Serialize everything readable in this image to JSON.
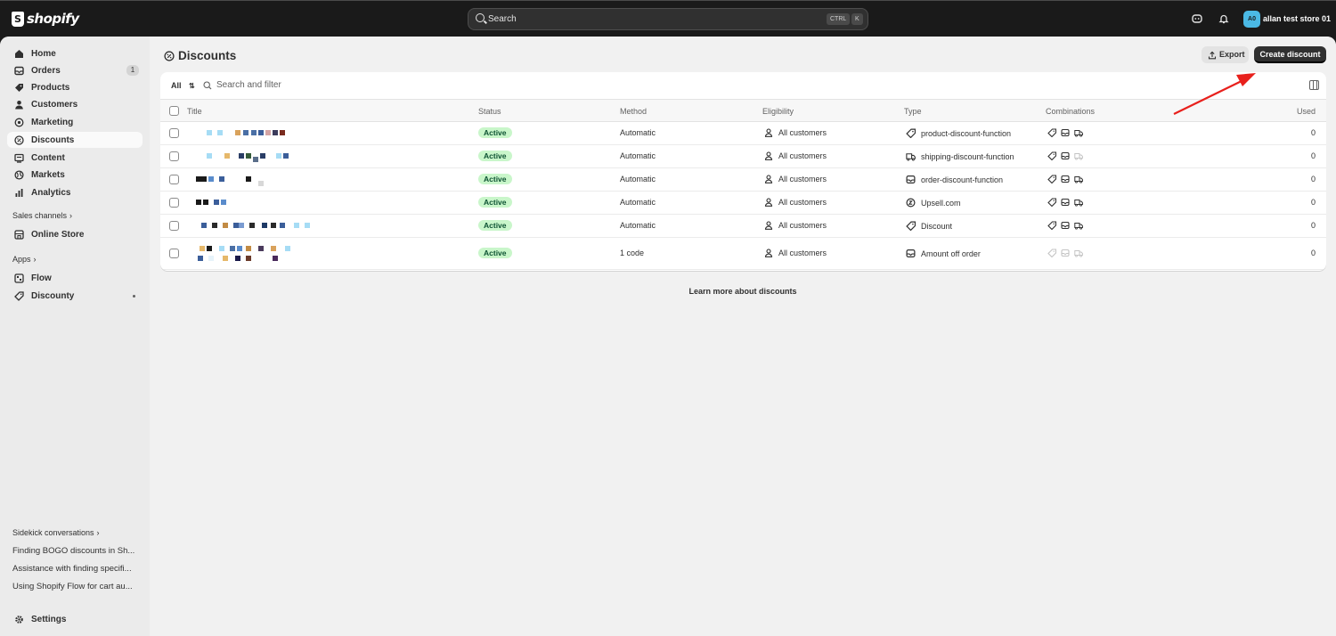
{
  "topbar": {
    "logo_text": "shopify",
    "search_placeholder": "Search",
    "shortcut_ctrl": "CTRL",
    "shortcut_key": "K",
    "store_initials": "A0",
    "store_name": "allan test store 01"
  },
  "sidebar": {
    "items": [
      {
        "label": "Home",
        "icon": "home-icon"
      },
      {
        "label": "Orders",
        "icon": "orders-icon",
        "badge": "1"
      },
      {
        "label": "Products",
        "icon": "tag-icon"
      },
      {
        "label": "Customers",
        "icon": "person-icon"
      },
      {
        "label": "Marketing",
        "icon": "target-icon"
      },
      {
        "label": "Discounts",
        "icon": "discount-icon",
        "selected": true
      },
      {
        "label": "Content",
        "icon": "content-icon"
      },
      {
        "label": "Markets",
        "icon": "globe-icon"
      },
      {
        "label": "Analytics",
        "icon": "bar-chart-icon"
      }
    ],
    "sales_channels_label": "Sales channels",
    "online_store_label": "Online Store",
    "apps_label": "Apps",
    "flow_label": "Flow",
    "discounty_label": "Discounty",
    "sidekick_label": "Sidekick conversations",
    "sidekick_items": [
      "Finding BOGO discounts in Sh...",
      "Assistance with finding specifi...",
      "Using Shopify Flow for cart au..."
    ],
    "settings_label": "Settings"
  },
  "page": {
    "title": "Discounts",
    "export_label": "Export",
    "create_label": "Create discount",
    "filter_all": "All",
    "filter_placeholder": "Search and filter",
    "learn_more": "Learn more about discounts"
  },
  "table": {
    "columns": [
      "Title",
      "Status",
      "Method",
      "Eligibility",
      "Type",
      "Combinations",
      "Used"
    ],
    "rows": [
      {
        "status": "Active",
        "method": "Automatic",
        "eligibility": "All customers",
        "type": "product-discount-function",
        "type_icon": "tag-icon",
        "combos": [
          "on",
          "on",
          "on"
        ],
        "used": "0"
      },
      {
        "status": "Active",
        "method": "Automatic",
        "eligibility": "All customers",
        "type": "shipping-discount-function",
        "type_icon": "truck-icon",
        "combos": [
          "on",
          "on",
          "off"
        ],
        "used": "0"
      },
      {
        "status": "Active",
        "method": "Automatic",
        "eligibility": "All customers",
        "type": "order-discount-function",
        "type_icon": "order-icon",
        "combos": [
          "on",
          "on",
          "on"
        ],
        "used": "0"
      },
      {
        "status": "Active",
        "method": "Automatic",
        "eligibility": "All customers",
        "type": "Upsell.com",
        "type_icon": "upsell-icon",
        "combos": [
          "on",
          "on",
          "on"
        ],
        "used": "0"
      },
      {
        "status": "Active",
        "method": "Automatic",
        "eligibility": "All customers",
        "type": "Discount",
        "type_icon": "tag-icon",
        "combos": [
          "on",
          "on",
          "on"
        ],
        "used": "0"
      },
      {
        "status": "Active",
        "method": "1 code",
        "eligibility": "All customers",
        "type": "Amount off order",
        "type_icon": "order-icon",
        "combos": [
          "off",
          "off",
          "off"
        ],
        "used": "0"
      }
    ]
  },
  "colors": {
    "accent_active_bg": "#c9f6ca",
    "annotation_arrow": "#e8201c",
    "store_avatar": "#4bb9e5"
  }
}
